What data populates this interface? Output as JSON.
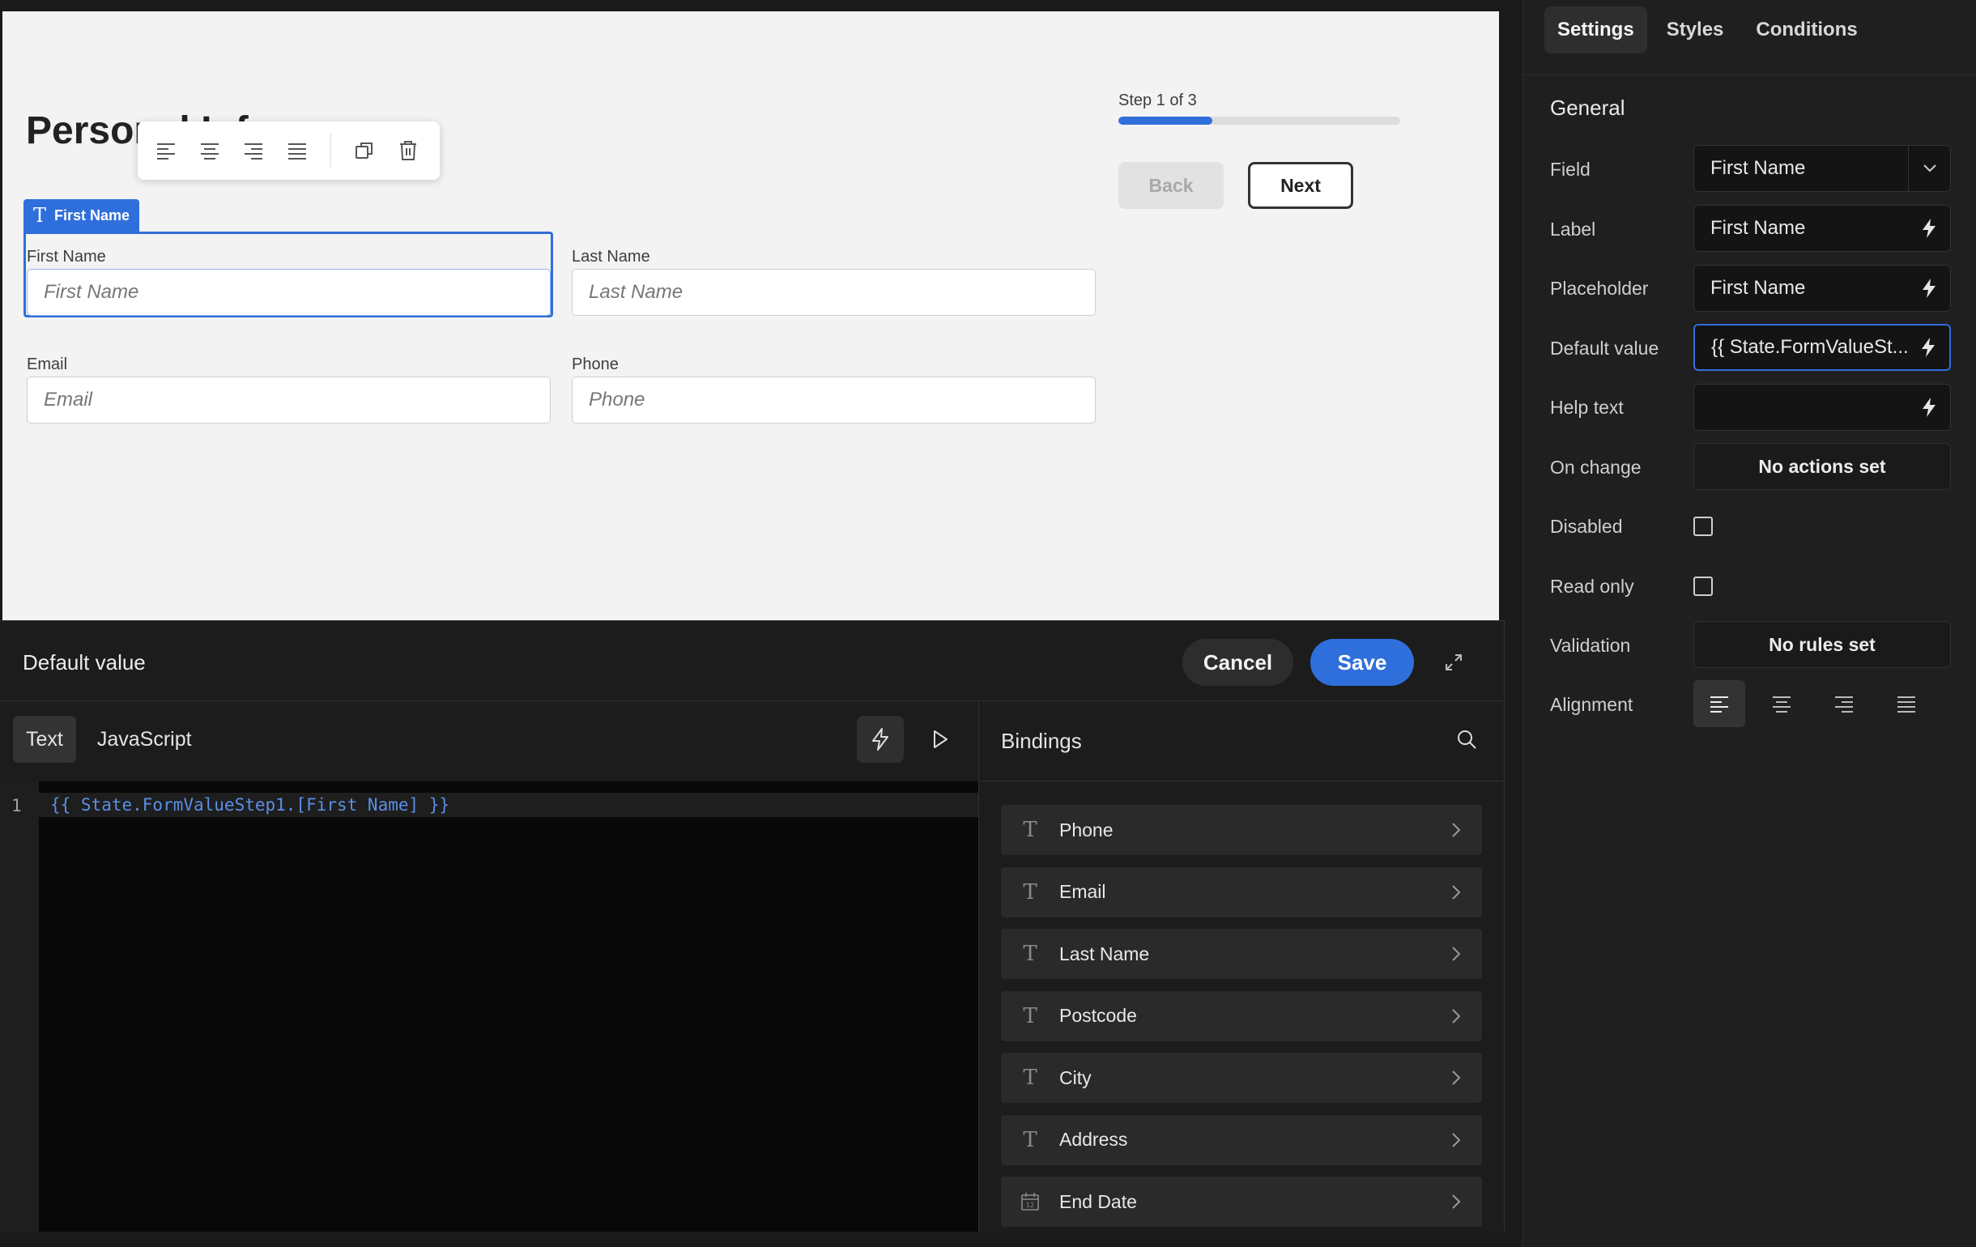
{
  "canvas": {
    "title": "Personal Inf",
    "selected_badge": "First Name",
    "fields": [
      {
        "label": "First Name",
        "placeholder": "First Name"
      },
      {
        "label": "Last Name",
        "placeholder": "Last Name"
      },
      {
        "label": "Email",
        "placeholder": "Email"
      },
      {
        "label": "Phone",
        "placeholder": "Phone"
      }
    ],
    "step_text": "Step 1 of 3",
    "progress_fraction": 0.333,
    "back_label": "Back",
    "next_label": "Next",
    "toolbar_icons": [
      "align-left-icon",
      "align-center-icon",
      "align-right-icon",
      "align-justify-icon",
      "duplicate-icon",
      "trash-icon"
    ]
  },
  "editor": {
    "title": "Default value",
    "cancel_label": "Cancel",
    "save_label": "Save",
    "tabs": [
      {
        "label": "Text"
      },
      {
        "label": "JavaScript"
      }
    ],
    "active_tab": "Text",
    "line_number": "1",
    "code": "{{ State.FormValueStep1.[First Name] }}",
    "bindings_title": "Bindings",
    "bindings": [
      {
        "label": "Phone",
        "icon": "text-type-icon"
      },
      {
        "label": "Email",
        "icon": "text-type-icon"
      },
      {
        "label": "Last Name",
        "icon": "text-type-icon"
      },
      {
        "label": "Postcode",
        "icon": "text-type-icon"
      },
      {
        "label": "City",
        "icon": "text-type-icon"
      },
      {
        "label": "Address",
        "icon": "text-type-icon"
      },
      {
        "label": "End Date",
        "icon": "calendar-icon"
      }
    ]
  },
  "panel": {
    "tabs": [
      {
        "label": "Settings"
      },
      {
        "label": "Styles"
      },
      {
        "label": "Conditions"
      }
    ],
    "active_tab": "Settings",
    "section_title": "General",
    "labels": {
      "field": "Field",
      "label": "Label",
      "placeholder": "Placeholder",
      "default_value": "Default value",
      "help_text": "Help text",
      "on_change": "On change",
      "disabled": "Disabled",
      "read_only": "Read only",
      "validation": "Validation",
      "alignment": "Alignment"
    },
    "values": {
      "field": "First Name",
      "label": "First Name",
      "placeholder": "First Name",
      "default_value": "{{ State.FormValueSt...",
      "help_text": "",
      "on_change": "No actions set",
      "disabled": false,
      "read_only": false,
      "validation": "No rules set",
      "alignment": "left"
    }
  },
  "colors": {
    "accent": "#2f6fdc",
    "canvas_bg": "#f3f3f3",
    "panel_bg": "#1f1f1f",
    "code_text": "#5b8fe6"
  }
}
